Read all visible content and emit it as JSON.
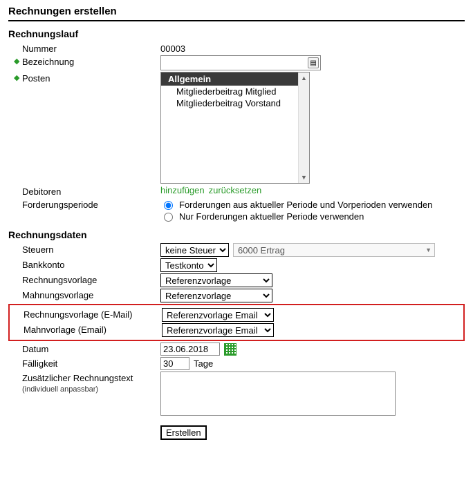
{
  "page_title": "Rechnungen erstellen",
  "section_run": {
    "heading": "Rechnungslauf",
    "number_label": "Nummer",
    "number_value": "00003",
    "name_label": "Bezeichnung",
    "name_value": "",
    "posten_label": "Posten",
    "list_header": "Allgemein",
    "list_items": [
      "Mitgliederbeitrag Mitglied",
      "Mitgliederbeitrag Vorstand"
    ],
    "debitoren_label": "Debitoren",
    "link_add": "hinzufügen",
    "link_reset": "zurücksetzen",
    "period_label": "Forderungsperiode",
    "radio1": "Forderungen aus aktueller Periode und Vorperioden verwenden",
    "radio2": "Nur Forderungen aktueller Periode verwenden"
  },
  "section_data": {
    "heading": "Rechnungsdaten",
    "tax_label": "Steuern",
    "tax_value": "keine Steuer",
    "account_value": "6000 Ertrag",
    "bank_label": "Bankkonto",
    "bank_value": "Testkonto",
    "tpl_invoice_label": "Rechnungsvorlage",
    "tpl_invoice_value": "Referenzvorlage",
    "tpl_reminder_label": "Mahnungsvorlage",
    "tpl_reminder_value": "Referenzvorlage",
    "tpl_invoice_email_label": "Rechnungsvorlage (E-Mail)",
    "tpl_invoice_email_value": "Referenzvorlage Email",
    "tpl_reminder_email_label": "Mahnvorlage (Email)",
    "tpl_reminder_email_value": "Referenzvorlage Email",
    "date_label": "Datum",
    "date_value": "23.06.2018",
    "due_label": "Fälligkeit",
    "due_value": "30",
    "due_unit": "Tage",
    "extra_label": "Zusätzlicher Rechnungstext",
    "extra_sub": "(individuell anpassbar)",
    "submit": "Erstellen"
  }
}
